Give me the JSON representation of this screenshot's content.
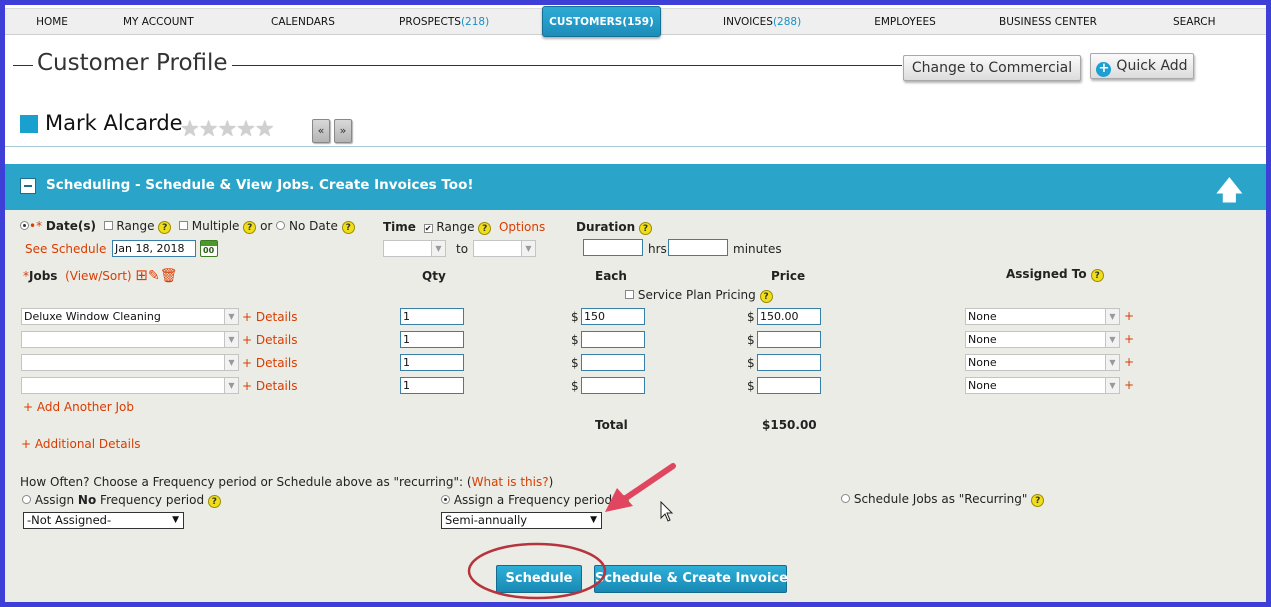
{
  "nav": {
    "home": "HOME",
    "my_account": "MY ACCOUNT",
    "calendars": "CALENDARS",
    "prospects": "PROSPECTS",
    "prospects_count": "(218)",
    "customers": "CUSTOMERS",
    "customers_count": "(159)",
    "invoices": "INVOICES",
    "invoices_count": "(288)",
    "employees": "EMPLOYEES",
    "business_center": "BUSINESS CENTER",
    "search": "SEARCH"
  },
  "header": {
    "title": "Customer Profile",
    "change_commercial": "Change to Commercial",
    "quick_add": "Quick Add",
    "customer_name": "Mark Alcarde",
    "stars": "★★★★★",
    "prev": "«",
    "next": "»"
  },
  "section": {
    "title": "Scheduling - Schedule & View Jobs. Create Invoices Too!",
    "minus_icon": "minus-box",
    "collapse_icon": "up-arrow"
  },
  "dates": {
    "star": "•*",
    "dates_label": "Date(s)",
    "range_label": "Range",
    "multiple_label": "Multiple",
    "or": "or",
    "no_date_label": "No Date",
    "see_schedule": "See Schedule",
    "date_value": "Jan 18, 2018",
    "calendar_icon_text": "00"
  },
  "time": {
    "label": "Time",
    "range_label": "Range",
    "options": "Options",
    "to": "to",
    "check_mark": "✔"
  },
  "duration": {
    "label": "Duration",
    "hrs": "hrs",
    "minutes": "minutes"
  },
  "jobs": {
    "star": "*",
    "label": "Jobs",
    "view_sort": "(View/Sort)",
    "qty_header": "Qty",
    "each_header": "Each",
    "price_header": "Price",
    "assigned_header": "Assigned To",
    "service_plan": "Service Plan Pricing",
    "details": "+ Details",
    "dollar": "$",
    "plus": "+",
    "rows": [
      {
        "job": "Deluxe Window Cleaning",
        "qty": "1",
        "each": "150",
        "price": "150.00",
        "assigned": "None"
      },
      {
        "job": "",
        "qty": "1",
        "each": "",
        "price": "",
        "assigned": "None"
      },
      {
        "job": "",
        "qty": "1",
        "each": "",
        "price": "",
        "assigned": "None"
      },
      {
        "job": "",
        "qty": "1",
        "each": "",
        "price": "",
        "assigned": "None"
      }
    ],
    "add_another": "+ Add Another Job",
    "total_label": "Total",
    "total_value": "$150.00",
    "additional_details": "+ Additional Details"
  },
  "frequency": {
    "question": "How Often? Choose a Frequency period or Schedule above as \"recurring\": (",
    "what_is_this": "What is this?",
    "close_paren": ")",
    "no_freq_a": "Assign ",
    "no_freq_b": "No",
    "no_freq_c": " Frequency period",
    "no_freq_value": "-Not Assigned-",
    "assign_freq": "Assign a Frequency period",
    "assign_freq_value": "Semi-annually",
    "recurring": "Schedule Jobs as \"Recurring\""
  },
  "actions": {
    "schedule": "Schedule",
    "schedule_invoice": "Schedule & Create Invoice"
  },
  "question_mark": "?",
  "colors": {
    "accent": "#2aa5c9",
    "link_red": "#d93c00",
    "annotation_arrow": "#e0465f",
    "annotation_ellipse": "#b5343d"
  }
}
